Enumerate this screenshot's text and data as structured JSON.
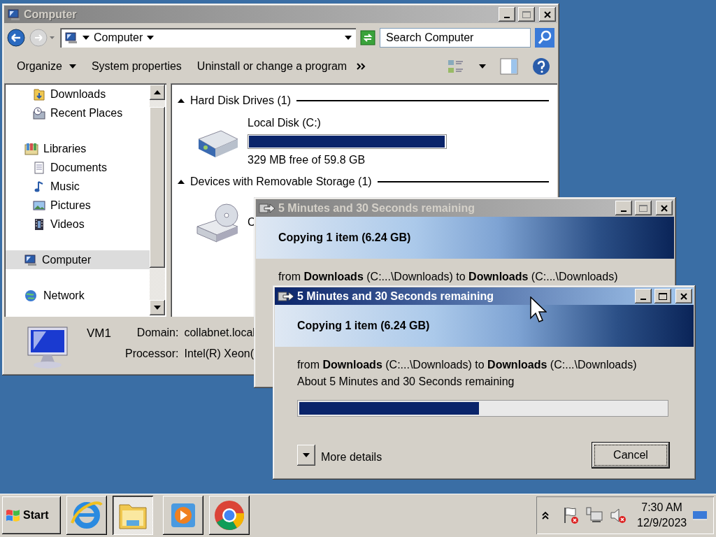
{
  "explorer": {
    "title": "Computer",
    "active": false,
    "address": "Computer",
    "search": {
      "placeholder": "Search Computer"
    },
    "toolbar": [
      {
        "label": "Organize",
        "dropdown": true
      },
      {
        "label": "System properties",
        "dropdown": false
      },
      {
        "label": "Uninstall or change a program",
        "dropdown": false
      }
    ],
    "nav": [
      {
        "label": "Downloads",
        "kind": "child",
        "selected": false
      },
      {
        "label": "Recent Places",
        "kind": "child",
        "selected": false
      },
      {
        "label": "Libraries",
        "kind": "group",
        "selected": false,
        "children": [
          {
            "label": "Documents",
            "selected": false
          },
          {
            "label": "Music",
            "selected": false
          },
          {
            "label": "Pictures",
            "selected": false
          },
          {
            "label": "Videos",
            "selected": false
          }
        ]
      },
      {
        "label": "Computer",
        "kind": "group",
        "selected": true
      },
      {
        "label": "Network",
        "kind": "group",
        "selected": false
      }
    ],
    "sections": [
      {
        "title": "Hard Disk Drives (1)",
        "expanded": true,
        "items": [
          {
            "name": "Local Disk (C:)",
            "level": 0.995,
            "free": "329 MB free of 59.8 GB"
          }
        ]
      },
      {
        "title": "Devices with Removable Storage (1)",
        "expanded": true,
        "items": [
          {
            "name": "C"
          }
        ]
      }
    ],
    "details": {
      "name": "VM1",
      "fields": [
        {
          "label": "Domain:",
          "value": "collabnet.local"
        },
        {
          "label": "Processor:",
          "value": "Intel(R) Xeon("
        }
      ]
    }
  },
  "dialogs": [
    {
      "title": "5 Minutes and 30 Seconds remaining",
      "active": false,
      "heading": "Copying 1 item (6.24 GB)",
      "from": "from **Downloads** (C:...\\Downloads)  to **Downloads** (C:...\\Downloads)"
    },
    {
      "title": "5 Minutes and 30 Seconds remaining",
      "active": true,
      "heading": "Copying 1 item (6.24 GB)",
      "from": "from **Downloads** (C:...\\Downloads)  to **Downloads** (C:...\\Downloads)",
      "remaining": "About 5 Minutes and 30 Seconds remaining",
      "level": 0.49,
      "more": "More details",
      "cancel": "Cancel"
    }
  ],
  "taskbar": {
    "start": "Start",
    "apps": [
      {
        "selected": false
      },
      {
        "selected": true
      },
      {
        "selected": false
      },
      {
        "selected": false
      }
    ],
    "time": "7:30 AM",
    "date": "12/9/2023"
  }
}
